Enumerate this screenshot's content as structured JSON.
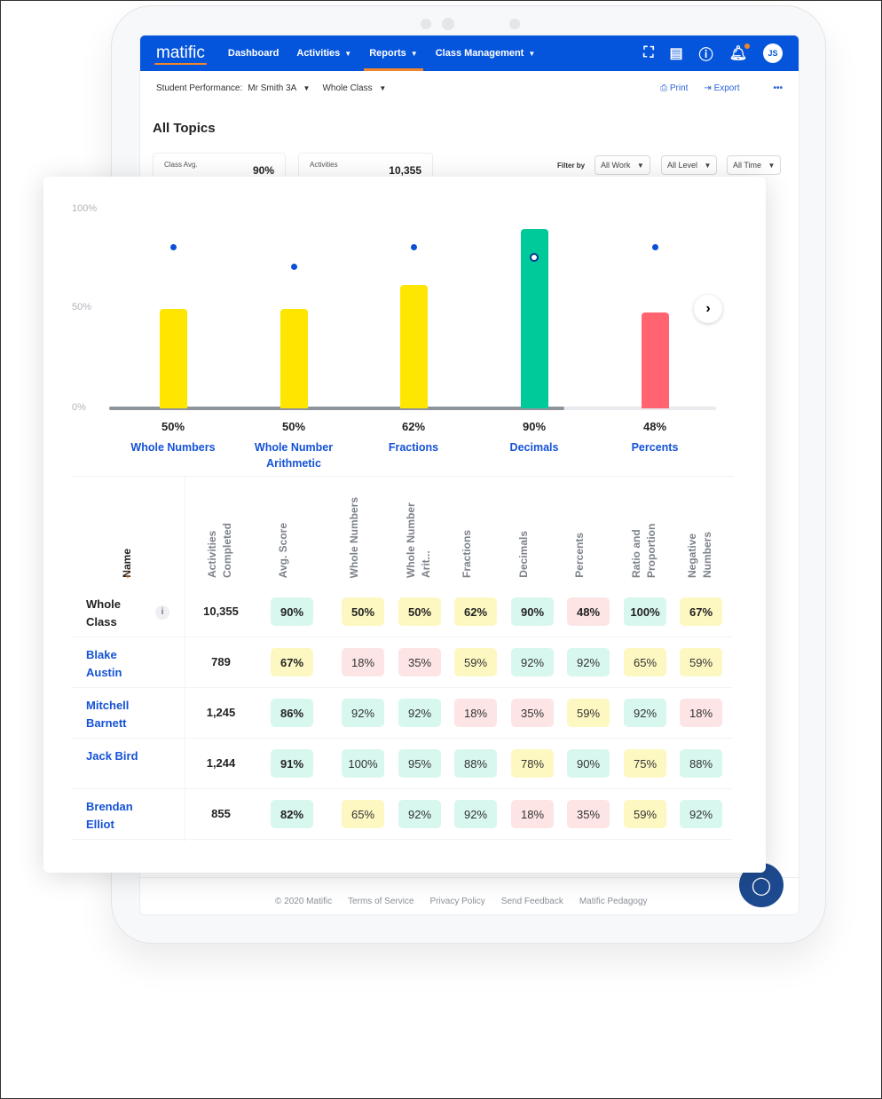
{
  "nav": {
    "logo": "matific",
    "items": [
      {
        "label": "Dashboard",
        "dropdown": false
      },
      {
        "label": "Activities",
        "dropdown": true
      },
      {
        "label": "Reports",
        "dropdown": true,
        "active": true
      },
      {
        "label": "Class Management",
        "dropdown": true
      }
    ],
    "icons": [
      "map-icon",
      "id-card-icon",
      "help-icon",
      "bell-icon"
    ],
    "avatar": "JS",
    "accent": "#0555dc",
    "highlight": "#f2862b"
  },
  "subheader": {
    "label": "Student Performance:",
    "class": "Mr Smith 3A",
    "scope": "Whole Class",
    "print": "Print",
    "export": "Export",
    "more": "•••"
  },
  "page_title": "All Topics",
  "stats": [
    {
      "label": "Class Avg.",
      "value": "90%"
    },
    {
      "label": "Activities",
      "value": "10,355"
    }
  ],
  "filters": {
    "label": "Filter by",
    "work": "All Work",
    "level": "All Level",
    "time": "All Time"
  },
  "chart_data": {
    "type": "bar",
    "yticks": [
      "100%",
      "50%",
      "0%"
    ],
    "ylim": [
      0,
      100
    ],
    "categories": [
      "Whole Numbers",
      "Whole Number Arithmetic",
      "Fractions",
      "Decimals",
      "Percents"
    ],
    "values": [
      50,
      50,
      62,
      90,
      48
    ],
    "value_labels": [
      "50%",
      "50%",
      "62%",
      "90%",
      "48%"
    ],
    "markers": [
      81,
      71,
      81,
      76,
      81
    ],
    "bar_colors": [
      "#ffe600",
      "#ffe600",
      "#ffe600",
      "#00c99a",
      "#ff6470"
    ],
    "scroll_progress": 75
  },
  "table": {
    "sort_icon": "arrow-down-icon",
    "columns": [
      "Name",
      "Activities Completed",
      "Avg. Score",
      "Whole Numbers",
      "Whole Number Arit...",
      "Fractions",
      "Decimals",
      "Percents",
      "Ratio and Proportion",
      "Negative Numbers"
    ],
    "rows": [
      {
        "name": "Whole Class",
        "activities": "10,355",
        "avg": "90%",
        "scores": [
          "50%",
          "50%",
          "62%",
          "90%",
          "48%",
          "100%",
          "67%"
        ],
        "info": "i"
      },
      {
        "name": "Blake Austin",
        "activities": "789",
        "avg": "67%",
        "scores": [
          "18%",
          "35%",
          "59%",
          "92%",
          "92%",
          "65%",
          "59%"
        ]
      },
      {
        "name": "Mitchell Barnett",
        "activities": "1,245",
        "avg": "86%",
        "scores": [
          "92%",
          "92%",
          "18%",
          "35%",
          "59%",
          "92%",
          "18%"
        ]
      },
      {
        "name": "Jack Bird",
        "activities": "1,244",
        "avg": "91%",
        "scores": [
          "100%",
          "95%",
          "88%",
          "78%",
          "90%",
          "75%",
          "88%"
        ]
      },
      {
        "name": "Brendan Elliot",
        "activities": "855",
        "avg": "82%",
        "scores": [
          "65%",
          "92%",
          "92%",
          "18%",
          "35%",
          "59%",
          "92%"
        ]
      }
    ],
    "score_colors": {
      "high": "#d8f7ef",
      "mid": "#fdf8c2",
      "low": "#fde5e5"
    }
  },
  "footer": [
    "© 2020 Matific",
    "Terms of Service",
    "Privacy Policy",
    "Send Feedback",
    "Matific Pedagogy"
  ]
}
